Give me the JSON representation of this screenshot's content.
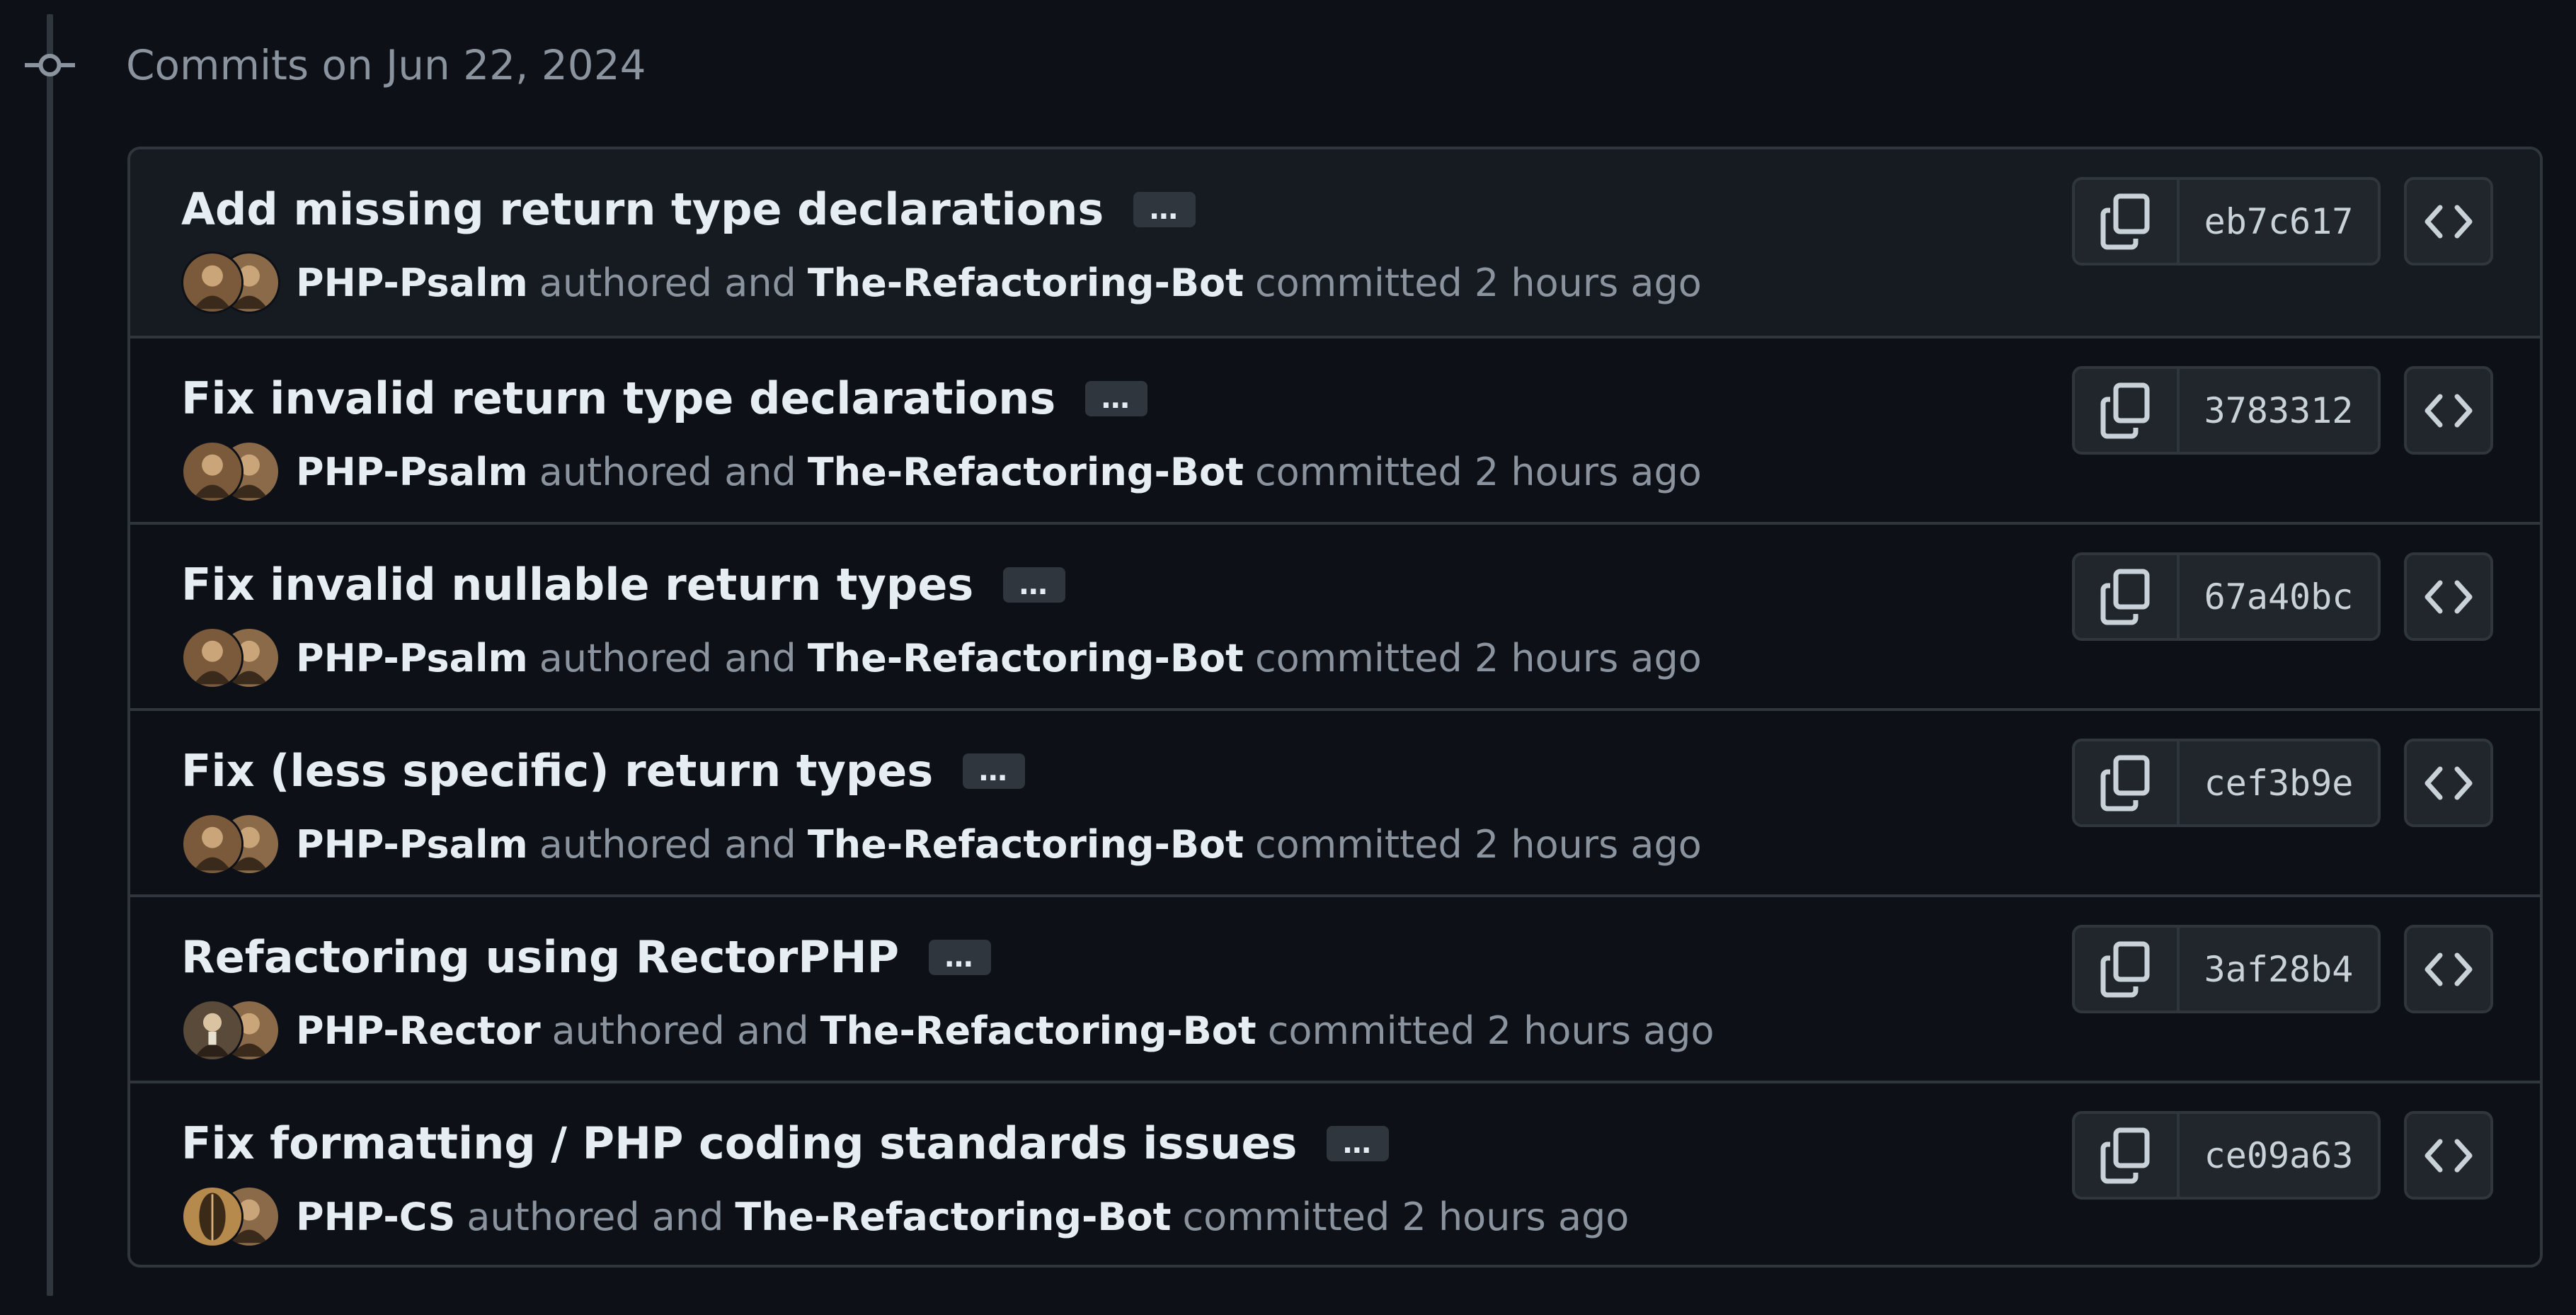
{
  "group": {
    "title": "Commits on Jun 22, 2024"
  },
  "commits": [
    {
      "message": "Add missing return type declarations",
      "author": "PHP-Psalm",
      "authored_text": "authored and",
      "committer": "The-Refactoring-Bot",
      "committed_text": "committed 2 hours ago",
      "sha": "eb7c617",
      "ellipsis": "…",
      "author_avatar": "owl"
    },
    {
      "message": "Fix invalid return type declarations",
      "author": "PHP-Psalm",
      "authored_text": "authored and",
      "committer": "The-Refactoring-Bot",
      "committed_text": "committed 2 hours ago",
      "sha": "3783312",
      "ellipsis": "…",
      "author_avatar": "owl"
    },
    {
      "message": "Fix invalid nullable return types",
      "author": "PHP-Psalm",
      "authored_text": "authored and",
      "committer": "The-Refactoring-Bot",
      "committed_text": "committed 2 hours ago",
      "sha": "67a40bc",
      "ellipsis": "…",
      "author_avatar": "owl"
    },
    {
      "message": "Fix (less specific) return types",
      "author": "PHP-Psalm",
      "authored_text": "authored and",
      "committer": "The-Refactoring-Bot",
      "committed_text": "committed 2 hours ago",
      "sha": "cef3b9e",
      "ellipsis": "…",
      "author_avatar": "owl"
    },
    {
      "message": "Refactoring using RectorPHP",
      "author": "PHP-Rector",
      "authored_text": "authored and",
      "committer": "The-Refactoring-Bot",
      "committed_text": "committed 2 hours ago",
      "sha": "3af28b4",
      "ellipsis": "…",
      "author_avatar": "rector"
    },
    {
      "message": "Fix formatting / PHP coding standards issues",
      "author": "PHP-CS",
      "authored_text": "authored and",
      "committer": "The-Refactoring-Bot",
      "committed_text": "committed 2 hours ago",
      "sha": "ce09a63",
      "ellipsis": "…",
      "author_avatar": "leaf"
    }
  ],
  "icons": {
    "commit_node": "git-commit-icon",
    "copy": "copy-icon",
    "browse": "code-icon"
  },
  "colors": {
    "background": "#0d1117",
    "row_highlight": "#161b22",
    "border": "#30363d",
    "button_bg": "#21262d",
    "text": "#e6edf3",
    "muted": "#8b949e"
  }
}
